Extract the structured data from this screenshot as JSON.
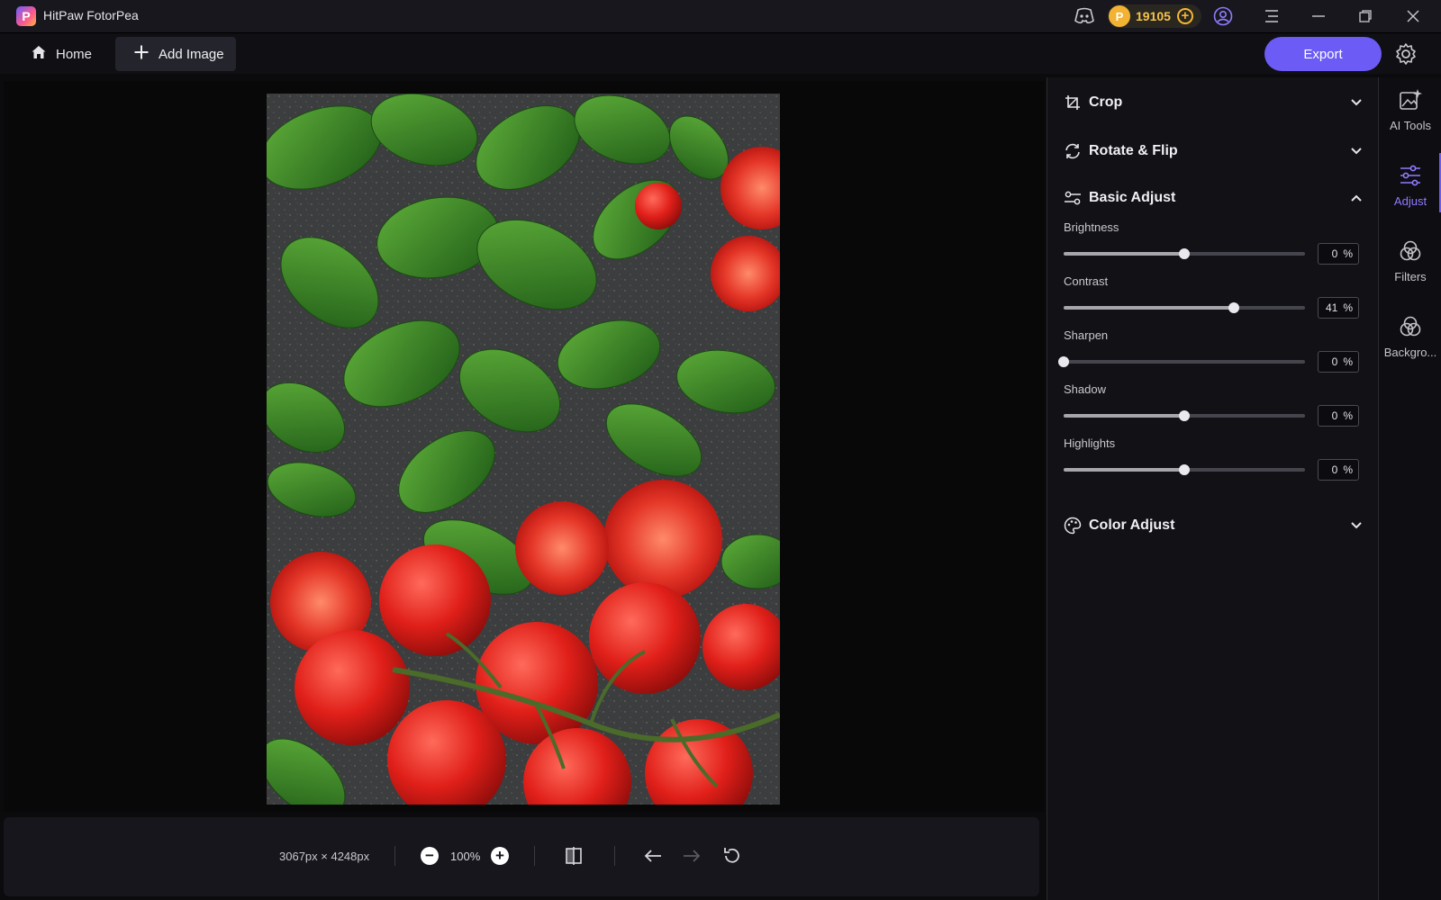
{
  "app": {
    "title": "HitPaw FotorPea",
    "logo_letter": "P"
  },
  "titlebar": {
    "coins": {
      "count": "19105",
      "badge": "P"
    },
    "icons": [
      "discord-icon",
      "coin-icon",
      "add-coins-icon",
      "account-icon",
      "menu-icon",
      "minimize-icon",
      "restore-icon",
      "close-icon"
    ]
  },
  "toolbar": {
    "home_label": "Home",
    "add_image_label": "Add Image",
    "export_label": "Export"
  },
  "canvas": {
    "image_alt": "basil and cherry tomatoes on dark stone surface"
  },
  "bottombar": {
    "dimensions": "3067px × 4248px",
    "zoom": "100%",
    "zoom_out": "−",
    "zoom_in": "+"
  },
  "panel": {
    "sections": {
      "crop": "Crop",
      "rotate": "Rotate & Flip",
      "basic": "Basic Adjust",
      "color": "Color Adjust"
    },
    "sliders": [
      {
        "label": "Brightness",
        "value": "0",
        "unit": "%",
        "level": 0.5
      },
      {
        "label": "Contrast",
        "value": "41",
        "unit": "%",
        "level": 0.705
      },
      {
        "label": "Sharpen",
        "value": "0",
        "unit": "%",
        "level": 0.0
      },
      {
        "label": "Shadow",
        "value": "0",
        "unit": "%",
        "level": 0.5
      },
      {
        "label": "Highlights",
        "value": "0",
        "unit": "%",
        "level": 0.5
      }
    ]
  },
  "rail": {
    "items": [
      {
        "label": "AI Tools",
        "icon": "ai-tools-icon"
      },
      {
        "label": "Adjust",
        "icon": "adjust-icon",
        "active": true
      },
      {
        "label": "Filters",
        "icon": "filters-icon"
      },
      {
        "label": "Backgro...",
        "icon": "background-icon"
      }
    ]
  },
  "colors": {
    "accent": "#6c5cf5",
    "coin": "#f2b233",
    "background": "#0b0b0e",
    "panel": "#111116"
  }
}
